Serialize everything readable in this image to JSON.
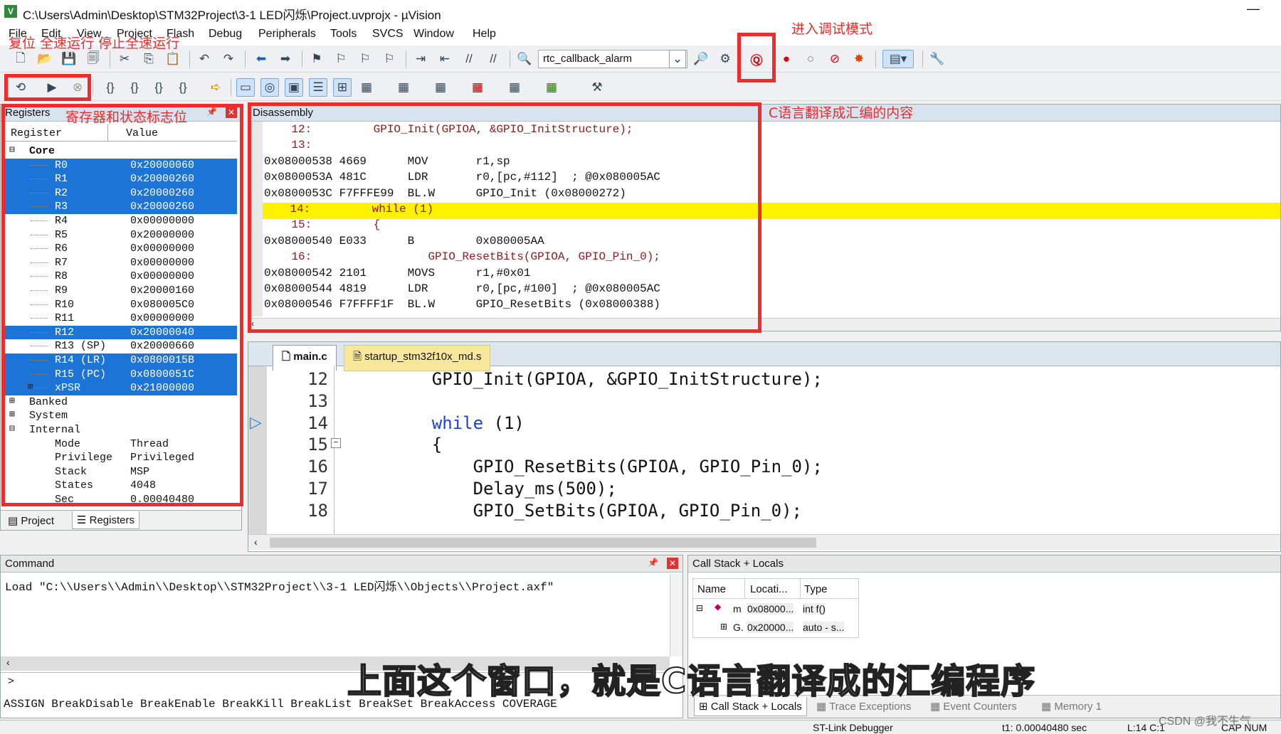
{
  "window": {
    "title": "C:\\Users\\Admin\\Desktop\\STM32Project\\3-1 LED闪烁\\Project.uvprojx - µVision",
    "minimize": "—"
  },
  "menu": [
    "File",
    "Edit",
    "View",
    "Project",
    "Flash",
    "Debug",
    "Peripherals",
    "Tools",
    "SVCS",
    "Window",
    "Help"
  ],
  "toolbar": {
    "target_combo": "rtc_callback_alarm"
  },
  "annotations": {
    "reset_run_stop": "复位 全速运行 停止全速运行",
    "enter_debug": "进入调试模式",
    "registers_note": "寄存器和状态标志位",
    "disasm_note": "C语言翻译成汇编的内容",
    "subtitle": "上面这个窗口，就是C语言翻译成的汇编程序",
    "watermark": "CSDN @我不生气"
  },
  "registers": {
    "panel_title": "Registers",
    "col_register": "Register",
    "col_value": "Value",
    "core_label": "Core",
    "rows": [
      {
        "name": "R0",
        "value": "0x20000060",
        "hl": true
      },
      {
        "name": "R1",
        "value": "0x20000260",
        "hl": true
      },
      {
        "name": "R2",
        "value": "0x20000260",
        "hl": true
      },
      {
        "name": "R3",
        "value": "0x20000260",
        "hl": true
      },
      {
        "name": "R4",
        "value": "0x00000000",
        "hl": false
      },
      {
        "name": "R5",
        "value": "0x20000000",
        "hl": false
      },
      {
        "name": "R6",
        "value": "0x00000000",
        "hl": false
      },
      {
        "name": "R7",
        "value": "0x00000000",
        "hl": false
      },
      {
        "name": "R8",
        "value": "0x00000000",
        "hl": false
      },
      {
        "name": "R9",
        "value": "0x20000160",
        "hl": false
      },
      {
        "name": "R10",
        "value": "0x080005C0",
        "hl": false
      },
      {
        "name": "R11",
        "value": "0x00000000",
        "hl": false
      },
      {
        "name": "R12",
        "value": "0x20000040",
        "hl": true
      },
      {
        "name": "R13 (SP)",
        "value": "0x20000660",
        "hl": false
      },
      {
        "name": "R14 (LR)",
        "value": "0x0800015B",
        "hl": true
      },
      {
        "name": "R15 (PC)",
        "value": "0x0800051C",
        "hl": true
      },
      {
        "name": "xPSR",
        "value": "0x21000000",
        "hl": true
      }
    ],
    "groups": [
      "Banked",
      "System",
      "Internal"
    ],
    "internal": [
      {
        "name": "Mode",
        "value": "Thread"
      },
      {
        "name": "Privilege",
        "value": "Privileged"
      },
      {
        "name": "Stack",
        "value": "MSP"
      },
      {
        "name": "States",
        "value": "4048"
      },
      {
        "name": "Sec",
        "value": "0.00040480"
      }
    ],
    "bottom_tabs": [
      "Project",
      "Registers"
    ]
  },
  "disassembly": {
    "title": "Disassembly",
    "lines": [
      "    12:         GPIO_Init(GPIOA, &GPIO_InitStructure);",
      "    13:",
      "0x08000538 4669      MOV       r1,sp",
      "0x0800053A 481C      LDR       r0,[pc,#112]  ; @0x080005AC",
      "0x0800053C F7FFFE99  BL.W      GPIO_Init (0x08000272)",
      "    14:         while (1)",
      "    15:         {",
      "0x08000540 E033      B         0x080005AA",
      "    16:                 GPIO_ResetBits(GPIOA, GPIO_Pin_0);",
      "0x08000542 2101      MOVS      r1,#0x01",
      "0x08000544 4819      LDR       r0,[pc,#100]  ; @0x080005AC",
      "0x08000546 F7FFFF1F  BL.W      GPIO_ResetBits (0x08000388)"
    ],
    "highlight_index": 5
  },
  "source": {
    "tabs": [
      "main.c",
      "startup_stm32f10x_md.s"
    ],
    "lines": [
      {
        "num": "12",
        "text": "    GPIO_Init(GPIOA, &GPIO_InitStructure);"
      },
      {
        "num": "13",
        "text": ""
      },
      {
        "num": "14",
        "text": "    while (1)"
      },
      {
        "num": "15",
        "text": "    {"
      },
      {
        "num": "16",
        "text": "        GPIO_ResetBits(GPIOA, GPIO_Pin_0);"
      },
      {
        "num": "17",
        "text": "        Delay_ms(500);"
      },
      {
        "num": "18",
        "text": "        GPIO_SetBits(GPIOA, GPIO_Pin_0);"
      }
    ]
  },
  "command": {
    "title": "Command",
    "output": "Load \"C:\\\\Users\\\\Admin\\\\Desktop\\\\STM32Project\\\\3-1 LED闪烁\\\\Objects\\\\Project.axf\"",
    "prompt": ">",
    "hints": "ASSIGN BreakDisable BreakEnable BreakKill BreakList BreakSet BreakAccess COVERAGE"
  },
  "callstack": {
    "title": "Call Stack + Locals",
    "cols": [
      "Name",
      "Locati...",
      "Type"
    ],
    "rows": [
      {
        "name": "m",
        "loc": "0x08000...",
        "type": "int f()"
      },
      {
        "name": "G.",
        "loc": "0x20000...",
        "type": "auto - s..."
      }
    ],
    "tabs": [
      "Call Stack + Locals",
      "Trace Exceptions",
      "Event Counters",
      "Memory 1"
    ]
  },
  "statusbar": {
    "debugger": "ST-Link Debugger",
    "time": "t1: 0.00040480 sec",
    "pos": "L:14 C:1",
    "caps": "CAP NUM"
  },
  "colors": {
    "highlight_line": "#fff200",
    "register_highlight": "#1c74d6",
    "annotation_red": "#ee2c2c",
    "keyword_blue": "#1f3fd6"
  }
}
